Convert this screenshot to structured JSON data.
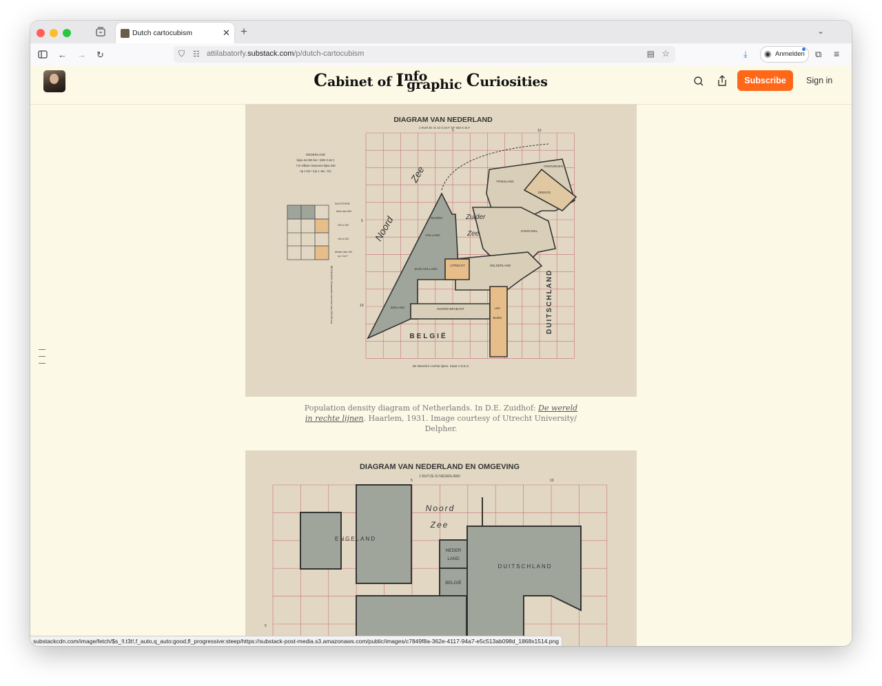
{
  "browser": {
    "tab_title": "Dutch cartocubism",
    "url_host": "attilabatorfy.substack.com",
    "url_path": "/p/dutch-cartocubism",
    "url_prefix": "attilabatorfy.",
    "account_label": "Anmelden",
    "status_url": "substackcdn.com/image/fetch/$s_!l.t3t!,f_auto,q_auto:good,fl_progressive:steep/https://substack-post-media.s3.amazonaws.com/public/images/c7849f8a-362e-4117-94a7-e5c513ab098d_1868x1514.png",
    "icons": [
      "tab-groups-icon",
      "close-icon",
      "plus-icon",
      "chevron-down-icon",
      "sidebar-icon",
      "back-arrow-icon",
      "forward-arrow-icon",
      "reload-icon",
      "shield-icon",
      "permissions-icon",
      "reader-view-icon",
      "bookmark-star-icon",
      "download-icon",
      "account-icon",
      "extensions-icon",
      "hamburger-menu-icon"
    ]
  },
  "site": {
    "title_part1": "abinet of ",
    "title_cap_c": "C",
    "title_info_top": "nfo",
    "title_info_I": "I",
    "title_graphic": "graphic ",
    "title_cap_c2": "C",
    "title_part3": "uriosities",
    "subscribe_label": "Subscribe",
    "signin_label": "Sign in",
    "accent_color": "#ff6719",
    "icons": [
      "search-icon",
      "share-icon",
      "toc-icon"
    ]
  },
  "figure1": {
    "title": "DIAGRAM VAN NEDERLAND",
    "subtitle": "1 RUITJE IS 10 G.M.F OF 550 K.M.F",
    "col_5": "5",
    "col_10": "10",
    "row_5": "5",
    "row_10": "10",
    "legend_header": "NEDERLAND",
    "legend_line1": "bijna 34.000 km.² (600 G.M.²)",
    "legend_line2": "7,9 millioen inwoners bijna 240",
    "legend_line3": "op 1 km.² (op 1 Jan. '31)",
    "density_title": "DICHTHEID",
    "density_1": "Meer dan 500",
    "density_2": "200 à 300",
    "density_3": "100 à 200",
    "density_4": "Minder dan 100",
    "density_5": "op 1 km.²",
    "noord_zee_1": "Noord",
    "noord_zee_2": "Zee",
    "zuider_zee_1": "Zuider",
    "zuider_zee_2": "Zee",
    "regions": {
      "groningen": "GRONINGEN",
      "friesland": "FRIESLAND",
      "drente": "DRENTE",
      "noord_holland": "NOORD-",
      "holland": "HOLLAND",
      "overijsel": "OVERIJSEL",
      "zuid_holland": "ZUID-HOLLAND",
      "utrecht": "UTRECHT",
      "gelderland": "GELDERLAND",
      "zeeland": "ZEELAND",
      "noord_brabant": "NOORD-BRABANT",
      "limburg_1": "LIM-",
      "limburg_2": "BURG",
      "belgie": "BELGIË",
      "duitschland": "DUITSCHLAND"
    },
    "vertical_note": "BEVOLKING  Gemeenten met meer dan 100.000 inw.",
    "footer": "De Wereld in rechte lijnen. Kaart 1    D.E.Z."
  },
  "caption": {
    "text_before": "Population density diagram of Netherlands. In D.E. Zuidhof: ",
    "link_text": "De wereld in rechte lijnen",
    "text_after": ". Haarlem, 1931. Image courtesy of Utrecht University/ Delpher."
  },
  "figure2": {
    "title": "DIAGRAM VAN NEDERLAND EN OMGEVING",
    "subtitle": "1 RUITJE IS NEDERLAND",
    "col_5": "5",
    "col_10": "10",
    "row_5": "5",
    "noord": "Noord",
    "zee": "Zee",
    "engeland": "ENGELAND",
    "neder": "NEDER",
    "land": "LAND",
    "belgie": "BELGIË",
    "duitschland": "DUITSCHLAND"
  }
}
